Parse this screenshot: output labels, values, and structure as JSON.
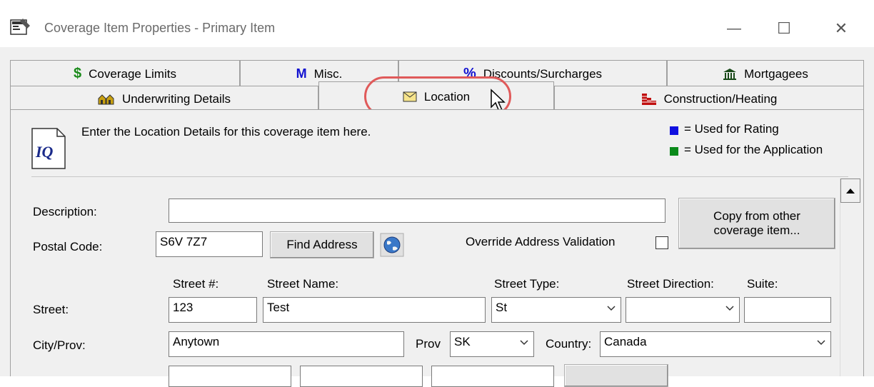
{
  "window": {
    "title": "Coverage Item Properties - Primary Item",
    "minimize_glyph": "—",
    "maximize_glyph": "☐",
    "close_glyph": "✕"
  },
  "tabs_row1": [
    {
      "label": "Coverage Limits",
      "icon": "dollar-icon",
      "glyph": "$",
      "color": "#1a8a1a"
    },
    {
      "label": "Misc.",
      "icon": "misc-m-icon",
      "glyph": "M",
      "color": "#1010d0"
    },
    {
      "label": "Discounts/Surcharges",
      "icon": "percent-icon",
      "glyph": "%",
      "color": "#1010d0"
    },
    {
      "label": "Mortgagees",
      "icon": "bank-icon",
      "glyph": "🏛",
      "color": "#2a6a2a"
    }
  ],
  "tabs_row2": [
    {
      "label": "Underwriting Details",
      "icon": "houses-icon"
    },
    {
      "label": "Location",
      "icon": "envelope-icon"
    },
    {
      "label": "Construction/Heating",
      "icon": "brick-wall-icon"
    }
  ],
  "info": {
    "message": "Enter the Location Details for this coverage item here.",
    "logo_text": "IQ",
    "legend": [
      {
        "label": "= Used for Rating",
        "color": "#1010e0"
      },
      {
        "label": "= Used for the Application",
        "color": "#0a8a1a"
      }
    ]
  },
  "form": {
    "description_label": "Description:",
    "description_value": "",
    "postal_label": "Postal Code:",
    "postal_value": "S6V 7Z7",
    "find_address": "Find Address",
    "override_label": "Override Address Validation",
    "copy_button": "Copy from other coverage item...",
    "street_label": "Street:",
    "street_num_label": "Street #:",
    "street_num_value": "123",
    "street_name_label": "Street Name:",
    "street_name_value": "Test",
    "street_type_label": "Street Type:",
    "street_type_value": "St",
    "street_dir_label": "Street Direction:",
    "street_dir_value": "",
    "suite_label": "Suite:",
    "suite_value": "",
    "city_label": "City/Prov:",
    "city_value": "Anytown",
    "prov_label": "Prov",
    "prov_value": "SK",
    "country_label": "Country:",
    "country_value": "Canada"
  }
}
